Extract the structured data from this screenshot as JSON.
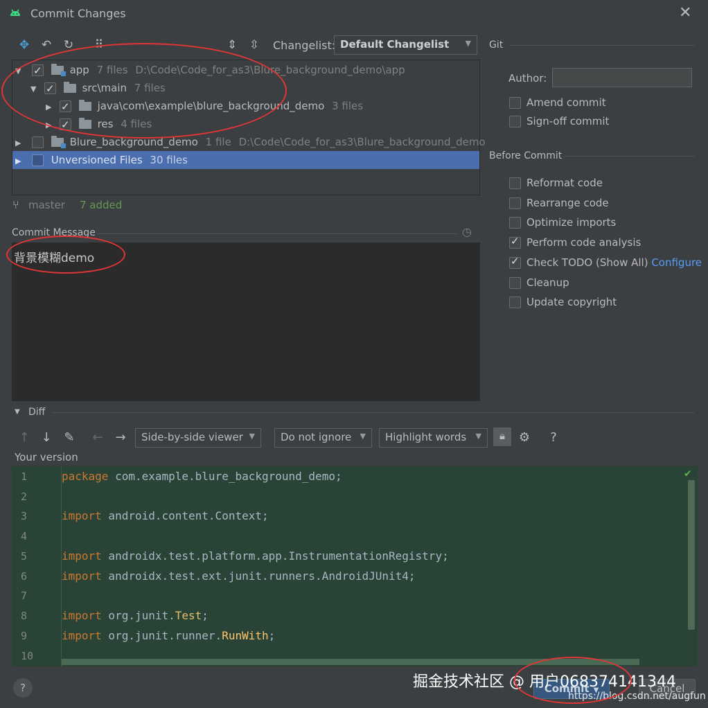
{
  "window": {
    "title": "Commit Changes"
  },
  "toolbar": {
    "changelist_label": "Changelist:",
    "changelist_value": "Default Changelist"
  },
  "tree": [
    {
      "name": "app",
      "count": "7 files",
      "path": "D:\\Code\\Code_for_as3\\Blure_background_demo\\app",
      "checked": true
    },
    {
      "name": "src\\main",
      "count": "7 files",
      "checked": true
    },
    {
      "name": "java\\com\\example\\blure_background_demo",
      "count": "3 files",
      "checked": true
    },
    {
      "name": "res",
      "count": "4 files",
      "checked": true
    },
    {
      "name": "Blure_background_demo",
      "count": "1 file",
      "path": "D:\\Code\\Code_for_as3\\Blure_background_demo",
      "checked": false
    },
    {
      "name": "Unversioned Files",
      "count": "30 files",
      "checked": false
    }
  ],
  "status": {
    "branch": "master",
    "added": "7 added"
  },
  "commit_message": {
    "label": "Commit Message",
    "value": "背景模糊demo"
  },
  "git": {
    "label": "Git",
    "author_label": "Author:",
    "author_value": "",
    "amend": "Amend commit",
    "signoff": "Sign-off commit"
  },
  "before_commit": {
    "label": "Before Commit",
    "options": [
      {
        "label": "Reformat code",
        "checked": false
      },
      {
        "label": "Rearrange code",
        "checked": false
      },
      {
        "label": "Optimize imports",
        "checked": false
      },
      {
        "label": "Perform code analysis",
        "checked": true
      },
      {
        "label": "Check TODO (Show All)",
        "checked": true,
        "link": "Configure"
      },
      {
        "label": "Cleanup",
        "checked": false
      },
      {
        "label": "Update copyright",
        "checked": false
      }
    ]
  },
  "diff": {
    "label": "Diff",
    "viewer": "Side-by-side viewer",
    "ignore": "Do not ignore",
    "highlight": "Highlight words",
    "your_version": "Your version",
    "help": "?"
  },
  "code": [
    {
      "n": "1",
      "kw": "package",
      "text": " com.example.blure_background_demo;"
    },
    {
      "n": "2",
      "kw": "",
      "text": ""
    },
    {
      "n": "3",
      "kw": "import",
      "text": " android.content.Context;"
    },
    {
      "n": "4",
      "kw": "",
      "text": ""
    },
    {
      "n": "5",
      "kw": "import",
      "text": " androidx.test.platform.app.InstrumentationRegistry;"
    },
    {
      "n": "6",
      "kw": "import",
      "text": " androidx.test.ext.junit.runners.AndroidJUnit4;"
    },
    {
      "n": "7",
      "kw": "",
      "text": ""
    },
    {
      "n": "8",
      "kw": "import",
      "text": " org.junit.",
      "cls": "Test",
      "tail": ";"
    },
    {
      "n": "9",
      "kw": "import",
      "text": " org.junit.runner.",
      "cls": "RunWith",
      "tail": ";"
    },
    {
      "n": "10",
      "kw": "",
      "text": ""
    }
  ],
  "footer": {
    "help": "?",
    "commit": "Commit",
    "cancel": "Cancel",
    "watermark": "掘金技术社区 @ 用户068374141344",
    "url": "https://blog.csdn.net/augfun"
  },
  "colors": {
    "accent": "#4b6eaf",
    "annotation": "#e23636",
    "added": "#629755",
    "link": "#589df6"
  }
}
